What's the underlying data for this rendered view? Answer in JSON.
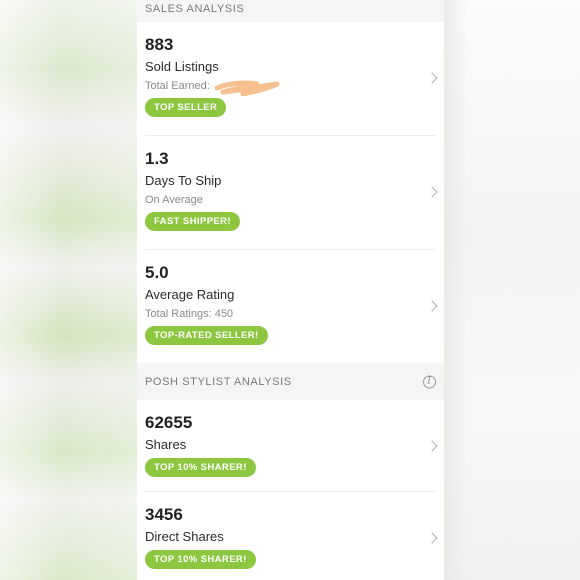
{
  "sales_section": {
    "title": "SALES ANALYSIS"
  },
  "sales_cards": [
    {
      "value": "883",
      "label": "Sold Listings",
      "sub": "Total Earned:",
      "badge": "TOP SELLER",
      "redacted": true
    },
    {
      "value": "1.3",
      "label": "Days To Ship",
      "sub": "On Average",
      "badge": "FAST SHIPPER!"
    },
    {
      "value": "5.0",
      "label": "Average Rating",
      "sub": "Total Ratings: 450",
      "badge": "TOP-RATED SELLER!"
    }
  ],
  "posh_section": {
    "title": "POSH STYLIST ANALYSIS",
    "info_icon": "info-icon"
  },
  "posh_cards": [
    {
      "value": "62655",
      "label": "Shares",
      "badge": "TOP 10% SHARER!"
    },
    {
      "value": "3456",
      "label": "Direct Shares",
      "badge": "TOP 10% SHARER!"
    }
  ],
  "colors": {
    "badge_green": "#8dc63f",
    "redaction_scribble": "#f7c08f",
    "panel_background": "#f5f5f5",
    "card_background": "#ffffff"
  },
  "icons": {
    "row_chevron": "chevron-right-icon",
    "section_info": "info-icon"
  }
}
